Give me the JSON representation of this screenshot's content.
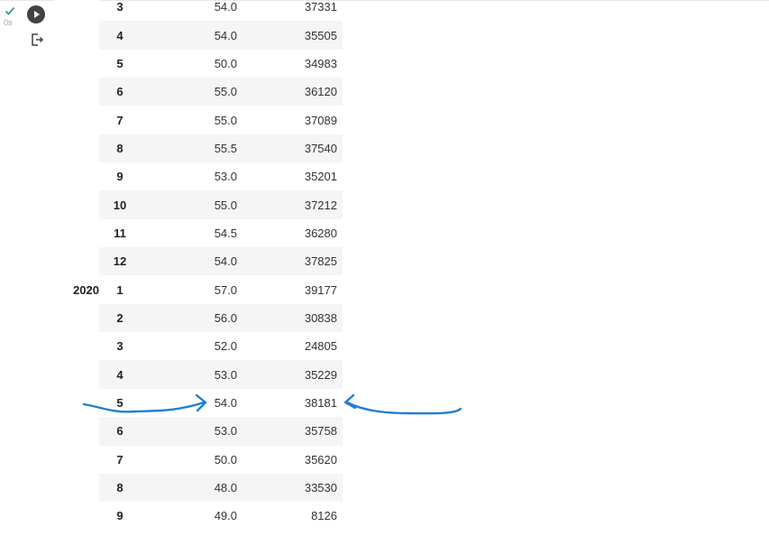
{
  "cell": {
    "status_time": "0s",
    "status_color": "#0f9d58",
    "run_icon": "play-circle-icon",
    "output_icon": "output-redirect-icon"
  },
  "table": {
    "rows": [
      {
        "year": "",
        "month": "3",
        "v1": "54.0",
        "v2": "37331"
      },
      {
        "year": "",
        "month": "4",
        "v1": "54.0",
        "v2": "35505"
      },
      {
        "year": "",
        "month": "5",
        "v1": "50.0",
        "v2": "34983"
      },
      {
        "year": "",
        "month": "6",
        "v1": "55.0",
        "v2": "36120"
      },
      {
        "year": "",
        "month": "7",
        "v1": "55.0",
        "v2": "37089"
      },
      {
        "year": "",
        "month": "8",
        "v1": "55.5",
        "v2": "37540"
      },
      {
        "year": "",
        "month": "9",
        "v1": "53.0",
        "v2": "35201"
      },
      {
        "year": "",
        "month": "10",
        "v1": "55.0",
        "v2": "37212"
      },
      {
        "year": "",
        "month": "11",
        "v1": "54.5",
        "v2": "36280"
      },
      {
        "year": "",
        "month": "12",
        "v1": "54.0",
        "v2": "37825"
      },
      {
        "year": "2020",
        "month": "1",
        "v1": "57.0",
        "v2": "39177"
      },
      {
        "year": "",
        "month": "2",
        "v1": "56.0",
        "v2": "30838"
      },
      {
        "year": "",
        "month": "3",
        "v1": "52.0",
        "v2": "24805"
      },
      {
        "year": "",
        "month": "4",
        "v1": "53.0",
        "v2": "35229"
      },
      {
        "year": "",
        "month": "5",
        "v1": "54.0",
        "v2": "38181"
      },
      {
        "year": "",
        "month": "6",
        "v1": "53.0",
        "v2": "35758"
      },
      {
        "year": "",
        "month": "7",
        "v1": "50.0",
        "v2": "35620"
      },
      {
        "year": "",
        "month": "8",
        "v1": "48.0",
        "v2": "33530"
      },
      {
        "year": "",
        "month": "9",
        "v1": "49.0",
        "v2": "8126"
      }
    ]
  },
  "annotation": {
    "color": "#1e7fd4",
    "highlighted_row": "2020-5"
  }
}
